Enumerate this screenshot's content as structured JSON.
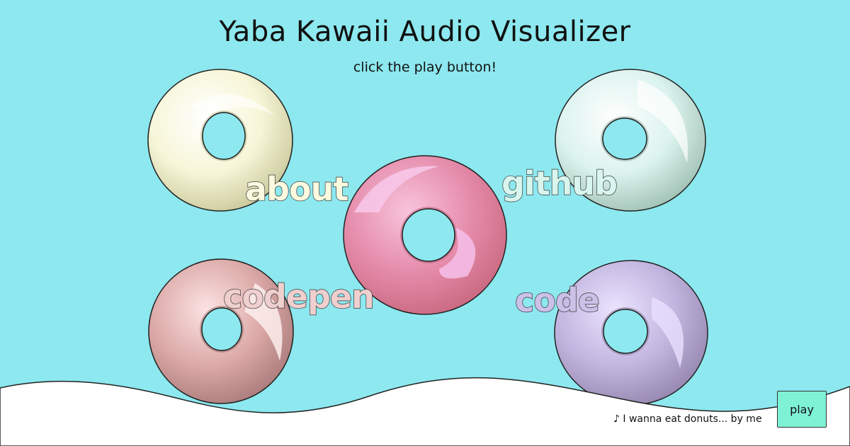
{
  "page": {
    "title": "Yaba Kawaii Audio Visualizer",
    "subtitle": "click the play button!"
  },
  "links": [
    {
      "label": "about",
      "color": "#fbf9df"
    },
    {
      "label": "github",
      "color": "#d8f6ee"
    },
    {
      "label": "codepen",
      "color": "#f0cfcf"
    },
    {
      "label": "code",
      "color": "#cbc1e8"
    }
  ],
  "player": {
    "track_icon": "music-note-icon",
    "track_text": "♪  I wanna eat donuts... by me",
    "play_label": "play"
  },
  "colors": {
    "background": "#8de8ef",
    "ground": "#ffffff",
    "play_button": "#7ff2d6",
    "donut_cream": "#f7f6d8",
    "donut_mint": "#e3f8f4",
    "donut_pink": "#e48aa8",
    "donut_rose": "#dca6a6",
    "donut_lavender": "#c2b5df"
  }
}
